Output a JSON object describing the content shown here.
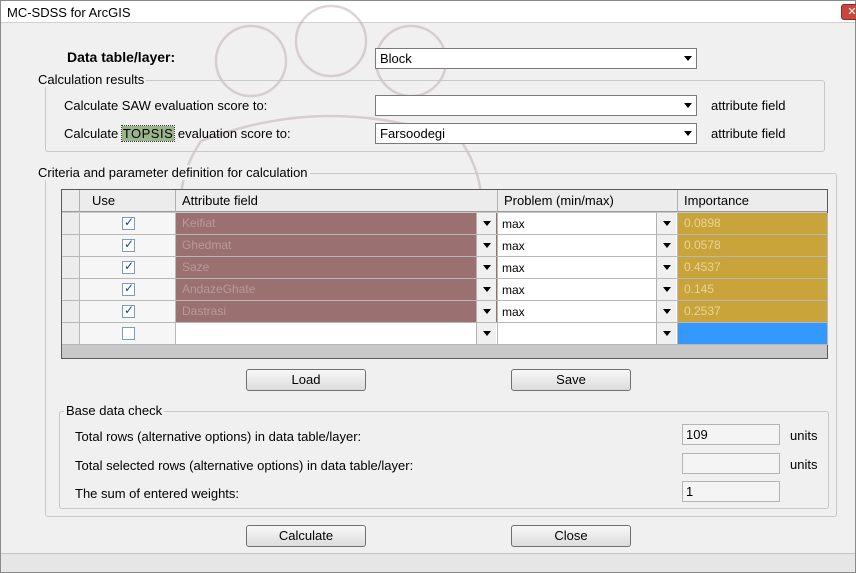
{
  "window": {
    "title": "MC-SDSS for ArcGIS",
    "close_icon": "✕"
  },
  "data_table": {
    "label": "Data table/layer:",
    "selected": "Block"
  },
  "calc_results": {
    "group_title": "Calculation results",
    "saw_label": "Calculate SAW evaluation score to:",
    "saw_value": "",
    "topsis_label_before": "Calculate ",
    "topsis_label_highlight": "TOPSIS",
    "topsis_label_after": " evaluation score to:",
    "topsis_value": "Farsoodegi",
    "suffix": "attribute field"
  },
  "criteria": {
    "group_title": "Criteria and parameter definition for calculation",
    "headers": [
      "Use",
      "Attribute field",
      "Problem (min/max)",
      "Importance"
    ],
    "rows": [
      {
        "checked": true,
        "attribute": "Keifiat",
        "problem": "max",
        "importance": "0.0898"
      },
      {
        "checked": true,
        "attribute": "Ghedmat",
        "problem": "max",
        "importance": "0.0578"
      },
      {
        "checked": true,
        "attribute": "Saze",
        "problem": "max",
        "importance": "0.4537"
      },
      {
        "checked": true,
        "attribute": "AndazeGhate",
        "problem": "max",
        "importance": "0.145"
      },
      {
        "checked": true,
        "attribute": "Dastrasi",
        "problem": "max",
        "importance": "0.2537"
      },
      {
        "checked": false,
        "attribute": "",
        "problem": "",
        "importance": ""
      }
    ]
  },
  "buttons": {
    "load": "Load",
    "save": "Save",
    "calculate": "Calculate",
    "close": "Close"
  },
  "base_check": {
    "group_title": "Base data check",
    "total_rows_label": "Total rows (alternative options) in data table/layer:",
    "total_rows_value": "109",
    "selected_rows_label": "Total selected rows (alternative options) in data table/layer:",
    "selected_rows_value": "",
    "sum_weights_label": "The sum of entered weights:",
    "sum_weights_value": "1",
    "units": "units"
  },
  "colors": {
    "attribute_cell": "#9a7070",
    "importance_cell": "#c8a43a",
    "selection": "#3399ff",
    "topsis_highlight": "#9cb48a"
  }
}
